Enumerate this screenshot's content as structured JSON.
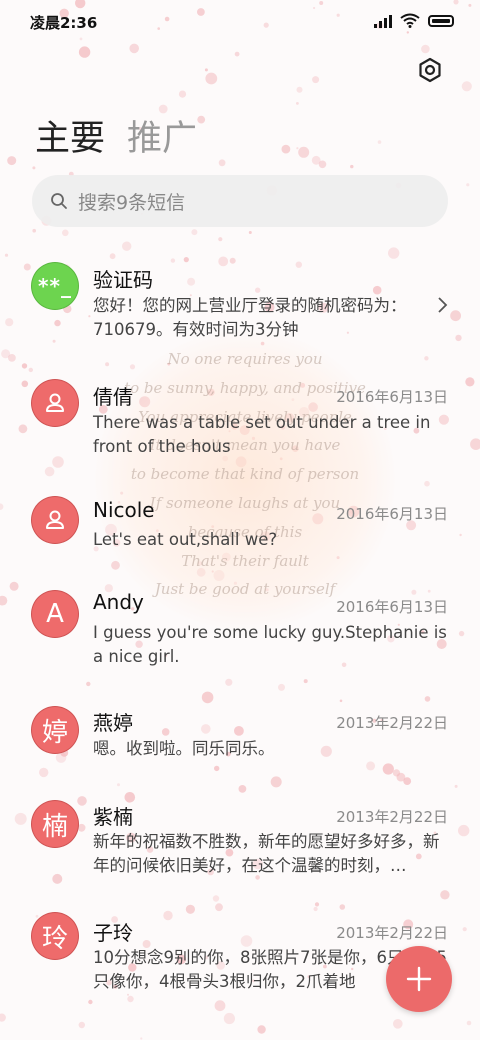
{
  "status_bar": {
    "time": "凌晨2:36"
  },
  "tabs": [
    {
      "label": "主要",
      "active": true
    },
    {
      "label": "推广",
      "active": false
    }
  ],
  "search": {
    "placeholder": "搜索9条短信"
  },
  "background_quote": [
    "No one requires you",
    "to be sunny, happy, and positive",
    "You appreciate lively people",
    "It doesn't mean you have",
    "to become that kind of person",
    "If someone laughs at you",
    "because of this",
    "That's their fault",
    "Just be good at yourself"
  ],
  "conversations": [
    {
      "avatar": "**_",
      "avatar_type": "green-code",
      "name": "验证码",
      "date": "",
      "preview": "您好！您的网上营业厅登录的随机密码为：710679。有效时间为3分钟",
      "has_chevron": true
    },
    {
      "avatar": "person-icon",
      "avatar_type": "person",
      "name": "倩倩",
      "date": "2016年6月13日",
      "preview": "There was a table set out under a tree in front of the hous"
    },
    {
      "avatar": "person-icon",
      "avatar_type": "person",
      "name": "Nicole",
      "date": "2016年6月13日",
      "preview": "Let's eat out,shall we?"
    },
    {
      "avatar": "A",
      "avatar_type": "letter",
      "name": "Andy",
      "date": "2016年6月13日",
      "preview": "I guess you're some lucky guy.Stephanie is a nice girl."
    },
    {
      "avatar": "婷",
      "avatar_type": "letter",
      "name": "燕婷",
      "date": "2013年2月22日",
      "preview": "嗯。收到啦。同乐同乐。"
    },
    {
      "avatar": "楠",
      "avatar_type": "letter",
      "name": "紫楠",
      "date": "2013年2月22日",
      "preview": "新年的祝福数不胜数，新年的愿望好多好多，新年的问候依旧美好，在这个温馨的时刻，…"
    },
    {
      "avatar": "玲",
      "avatar_type": "letter",
      "name": "子玲",
      "date": "2013年2月22日",
      "preview": "10分想念9别的你，8张照片7张是你，6只小狗5只像你，4根骨头3根归你，2爪着地"
    }
  ],
  "colors": {
    "accent": "#ec6a6a",
    "code_avatar": "#6dd44f",
    "speckle": "#f2b9bd"
  }
}
